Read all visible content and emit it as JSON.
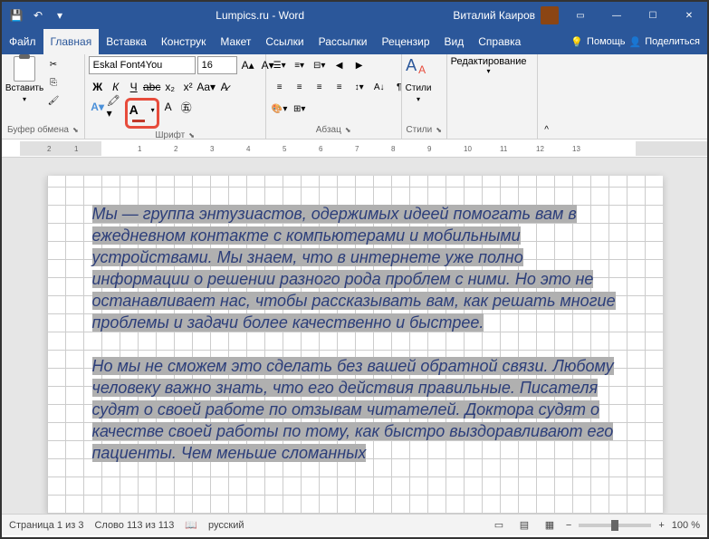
{
  "title": "Lumpics.ru - Word",
  "user": "Виталий Каиров",
  "tabs": {
    "file": "Файл",
    "home": "Главная",
    "insert": "Вставка",
    "design": "Конструк",
    "layout": "Макет",
    "references": "Ссылки",
    "mailings": "Рассылки",
    "review": "Рецензир",
    "view": "Вид",
    "help": "Справка",
    "tell_me": "Помощь",
    "share": "Поделиться"
  },
  "clipboard": {
    "paste": "Вставить",
    "label": "Буфер обмена"
  },
  "font": {
    "name": "Eskal Font4You",
    "size": "16",
    "label": "Шрифт"
  },
  "paragraph": {
    "label": "Абзац"
  },
  "styles": {
    "btn": "Стили",
    "label": "Стили"
  },
  "editing": {
    "btn": "Редактирование"
  },
  "ruler_ticks": [
    "2",
    "1",
    "1",
    "2",
    "3",
    "4",
    "5",
    "6",
    "7",
    "8",
    "9",
    "10",
    "11",
    "12",
    "13"
  ],
  "document": {
    "paragraph1": "Мы — группа энтузиастов, одержимых идеей помогать вам в ежедневном контакте с компьютерами и мобильными устройствами. Мы знаем, что в интернете уже полно информации о решении разного рода проблем с ними. Но это не останавливает нас, чтобы рассказывать вам, как решать многие проблемы и задачи более качественно и быстрее.",
    "paragraph2": "Но мы не сможем это сделать без вашей обратной связи. Любому человеку важно знать, что его действия правильные. Писателя судят о своей работе по отзывам читателей. Доктора судят о качестве своей работы по тому, как быстро выздоравливают его пациенты. Чем меньше сломанных"
  },
  "status": {
    "page": "Страница 1 из 3",
    "words": "Слово 113 из 113",
    "language": "русский",
    "zoom": "100 %"
  }
}
